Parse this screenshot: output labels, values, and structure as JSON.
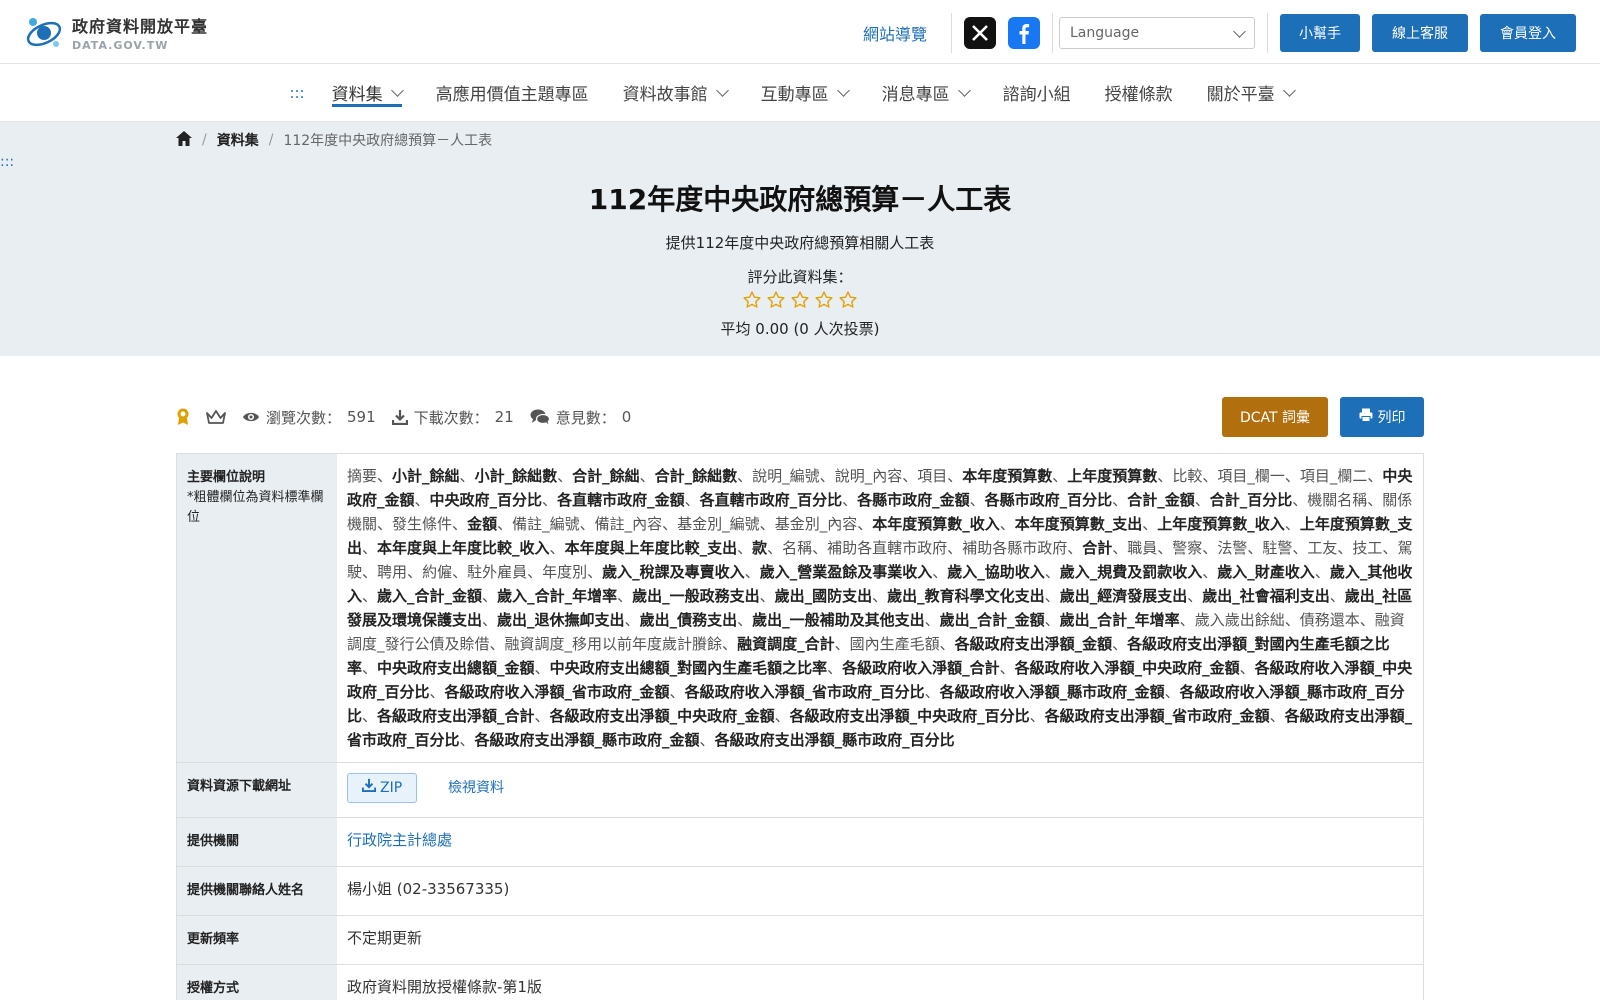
{
  "header": {
    "logo_cn": "政府資料開放平臺",
    "logo_en": "DATA.GOV.TW",
    "sitemap": "網站導覽",
    "language_placeholder": "Language",
    "help": "小幫手",
    "service": "線上客服",
    "login": "會員登入"
  },
  "nav": {
    "dots": ":::",
    "items": [
      "資料集",
      "高應用價值主題專區",
      "資料故事館",
      "互動專區",
      "消息專區",
      "諮詢小組",
      "授權條款",
      "關於平臺"
    ]
  },
  "breadcrumb": {
    "dataset": "資料集",
    "current": "112年度中央政府總預算－人工表"
  },
  "hero": {
    "dots": ":::",
    "title": "112年度中央政府總預算－人工表",
    "description": "提供112年度中央政府總預算相關人工表",
    "rate_label": "評分此資料集：",
    "rating_value": 0,
    "average": "平均 0.00 (0 人次投票)"
  },
  "stats": {
    "views_label": "瀏覽次數：",
    "views": "591",
    "downloads_label": "下載次數：",
    "downloads": "21",
    "comments_label": "意見數：",
    "comments": "0",
    "dcat": "DCAT 詞彙",
    "print": "列印"
  },
  "table": {
    "fields_label": "主要欄位說明",
    "fields_note": "*粗體欄位為資料標準欄位",
    "fields_content": [
      {
        "t": "摘要",
        "b": false
      },
      {
        "t": "小計_餘絀",
        "b": true
      },
      {
        "t": "小計_餘絀數",
        "b": true
      },
      {
        "t": "合計_餘絀",
        "b": true
      },
      {
        "t": "合計_餘絀數",
        "b": true
      },
      {
        "t": "說明_編號",
        "b": false
      },
      {
        "t": "說明_內容",
        "b": false
      },
      {
        "t": "項目",
        "b": false
      },
      {
        "t": "本年度預算數",
        "b": true
      },
      {
        "t": "上年度預算數",
        "b": true
      },
      {
        "t": "比較",
        "b": false
      },
      {
        "t": "項目_欄一",
        "b": false
      },
      {
        "t": "項目_欄二",
        "b": false
      },
      {
        "t": "中央政府_金額",
        "b": true
      },
      {
        "t": "中央政府_百分比",
        "b": true
      },
      {
        "t": "各直轄市政府_金額",
        "b": true
      },
      {
        "t": "各直轄市政府_百分比",
        "b": true
      },
      {
        "t": "各縣市政府_金額",
        "b": true
      },
      {
        "t": "各縣市政府_百分比",
        "b": true
      },
      {
        "t": "合計_金額",
        "b": true
      },
      {
        "t": "合計_百分比",
        "b": true
      },
      {
        "t": "機關名稱",
        "b": false
      },
      {
        "t": "關係機關",
        "b": false
      },
      {
        "t": "發生條件",
        "b": false
      },
      {
        "t": "金額",
        "b": true
      },
      {
        "t": "備註_編號",
        "b": false
      },
      {
        "t": "備註_內容",
        "b": false
      },
      {
        "t": "基金別_編號",
        "b": false
      },
      {
        "t": "基金別_內容",
        "b": false
      },
      {
        "t": "本年度預算數_收入",
        "b": true
      },
      {
        "t": "本年度預算數_支出",
        "b": true
      },
      {
        "t": "上年度預算數_收入",
        "b": true
      },
      {
        "t": "上年度預算數_支出",
        "b": true
      },
      {
        "t": "本年度與上年度比較_收入",
        "b": true
      },
      {
        "t": "本年度與上年度比較_支出",
        "b": true
      },
      {
        "t": "款",
        "b": true
      },
      {
        "t": "名稱",
        "b": false
      },
      {
        "t": "補助各直轄市政府",
        "b": false
      },
      {
        "t": "補助各縣市政府",
        "b": false
      },
      {
        "t": "合計",
        "b": true
      },
      {
        "t": "職員",
        "b": false
      },
      {
        "t": "警察",
        "b": false
      },
      {
        "t": "法警",
        "b": false
      },
      {
        "t": "駐警",
        "b": false
      },
      {
        "t": "工友",
        "b": false
      },
      {
        "t": "技工",
        "b": false
      },
      {
        "t": "駕駛",
        "b": false
      },
      {
        "t": "聘用",
        "b": false
      },
      {
        "t": "約僱",
        "b": false
      },
      {
        "t": "駐外雇員",
        "b": false
      },
      {
        "t": "年度別",
        "b": false
      },
      {
        "t": "歲入_稅課及專賣收入",
        "b": true
      },
      {
        "t": "歲入_營業盈餘及事業收入",
        "b": true
      },
      {
        "t": "歲入_協助收入",
        "b": true
      },
      {
        "t": "歲入_規費及罰款收入",
        "b": true
      },
      {
        "t": "歲入_財產收入",
        "b": true
      },
      {
        "t": "歲入_其他收入",
        "b": true
      },
      {
        "t": "歲入_合計_金額",
        "b": true
      },
      {
        "t": "歲入_合計_年增率",
        "b": true
      },
      {
        "t": "歲出_一般政務支出",
        "b": true
      },
      {
        "t": "歲出_國防支出",
        "b": true
      },
      {
        "t": "歲出_教育科學文化支出",
        "b": true
      },
      {
        "t": "歲出_經濟發展支出",
        "b": true
      },
      {
        "t": "歲出_社會福利支出",
        "b": true
      },
      {
        "t": "歲出_社區發展及環境保護支出",
        "b": true
      },
      {
        "t": "歲出_退休撫卹支出",
        "b": true
      },
      {
        "t": "歲出_債務支出",
        "b": true
      },
      {
        "t": "歲出_一般補助及其他支出",
        "b": true
      },
      {
        "t": "歲出_合計_金額",
        "b": true
      },
      {
        "t": "歲出_合計_年增率",
        "b": true
      },
      {
        "t": "歲入歲出餘絀",
        "b": false
      },
      {
        "t": "債務還本",
        "b": false
      },
      {
        "t": "融資調度_發行公債及賒借",
        "b": false
      },
      {
        "t": "融資調度_移用以前年度歲計賸餘",
        "b": false
      },
      {
        "t": "融資調度_合計",
        "b": true
      },
      {
        "t": "國內生產毛額",
        "b": false
      },
      {
        "t": "各級政府支出淨額_金額",
        "b": true
      },
      {
        "t": "各級政府支出淨額_對國內生產毛額之比率",
        "b": true
      },
      {
        "t": "中央政府支出總額_金額",
        "b": true
      },
      {
        "t": "中央政府支出總額_對國內生產毛額之比率",
        "b": true
      },
      {
        "t": "各級政府收入淨額_合計",
        "b": true
      },
      {
        "t": "各級政府收入淨額_中央政府_金額",
        "b": true
      },
      {
        "t": "各級政府收入淨額_中央政府_百分比",
        "b": true
      },
      {
        "t": "各級政府收入淨額_省市政府_金額",
        "b": true
      },
      {
        "t": "各級政府收入淨額_省市政府_百分比",
        "b": true
      },
      {
        "t": "各級政府收入淨額_縣市政府_金額",
        "b": true
      },
      {
        "t": "各級政府收入淨額_縣市政府_百分比",
        "b": true
      },
      {
        "t": "各級政府支出淨額_合計",
        "b": true
      },
      {
        "t": "各級政府支出淨額_中央政府_金額",
        "b": true
      },
      {
        "t": "各級政府支出淨額_中央政府_百分比",
        "b": true
      },
      {
        "t": "各級政府支出淨額_省市政府_金額",
        "b": true
      },
      {
        "t": "各級政府支出淨額_省市政府_百分比",
        "b": true
      },
      {
        "t": "各級政府支出淨額_縣市政府_金額",
        "b": true
      },
      {
        "t": "各級政府支出淨額_縣市政府_百分比",
        "b": true
      }
    ],
    "download_label": "資料資源下載網址",
    "zip": "ZIP",
    "view_data": "檢視資料",
    "provider_label": "提供機關",
    "provider": "行政院主計總處",
    "contact_label": "提供機關聯絡人姓名",
    "contact": "楊小姐 (02-33567335)",
    "frequency_label": "更新頻率",
    "frequency": "不定期更新",
    "license_label": "授權方式",
    "license": "政府資料開放授權條款-第1版"
  },
  "colors": {
    "primary": "#1d6fb8",
    "dcat": "#b26f0d",
    "hero_bg": "#e9eef3",
    "star": "#e0a100"
  },
  "icons": [
    "home-icon",
    "x-logo-icon",
    "facebook-icon",
    "badge-icon",
    "crown-icon",
    "eye-icon",
    "download-icon",
    "comments-icon",
    "print-icon",
    "star-icon"
  ]
}
